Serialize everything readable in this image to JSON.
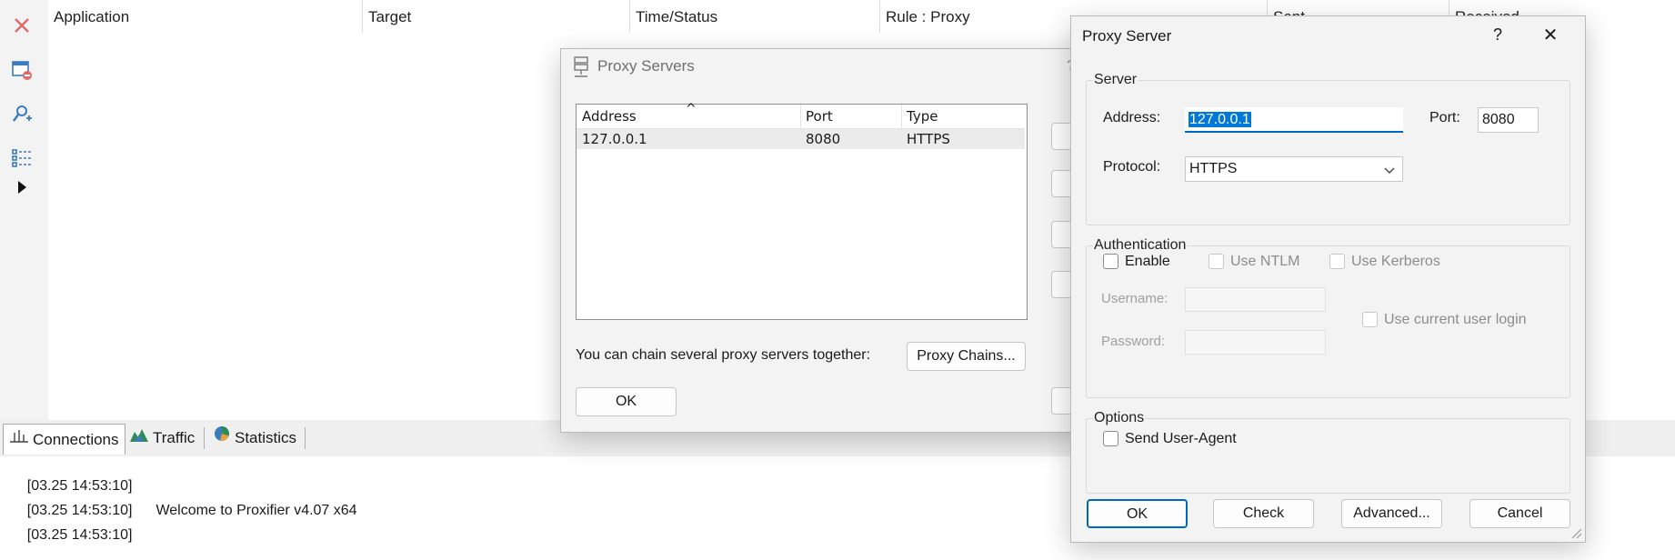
{
  "connections": {
    "columns": [
      "Application",
      "Target",
      "Time/Status",
      "Rule : Proxy",
      "Sent",
      "Received"
    ]
  },
  "toolbar": {
    "icons": [
      "close-x-icon",
      "window-remove-icon",
      "find-user-icon",
      "list-icon",
      "play-arrow-icon"
    ]
  },
  "tabs": [
    {
      "label": "Connections",
      "icon": "connections-icon"
    },
    {
      "label": "Traffic",
      "icon": "traffic-icon"
    },
    {
      "label": "Statistics",
      "icon": "statistics-icon"
    }
  ],
  "log": [
    {
      "time": "[03.25 14:53:10]",
      "message": ""
    },
    {
      "time": "[03.25 14:53:10]",
      "message": "Welcome to Proxifier v4.07 x64"
    },
    {
      "time": "[03.25 14:53:10]",
      "message": ""
    }
  ],
  "proxy_servers_dialog": {
    "title": "Proxy Servers",
    "columns": [
      "Address",
      "Port",
      "Type"
    ],
    "sort_indicator": "^",
    "rows": [
      {
        "address": "127.0.0.1",
        "port": "8080",
        "type": "HTTPS"
      }
    ],
    "chain_text": "You can chain several proxy servers together:",
    "proxy_chains_button": "Proxy Chains...",
    "ok_button": "OK",
    "title_help_partial": "?"
  },
  "proxy_server_dialog": {
    "title": "Proxy Server",
    "help": "?",
    "close": "✕",
    "server_group": "Server",
    "address_label": "Address:",
    "address_value": "127.0.0.1",
    "port_label": "Port:",
    "port_value": "8080",
    "protocol_label": "Protocol:",
    "protocol_value": "HTTPS",
    "auth_group": "Authentication",
    "enable_label": "Enable",
    "use_ntlm_label": "Use NTLM",
    "use_kerberos_label": "Use Kerberos",
    "username_label": "Username:",
    "password_label": "Password:",
    "use_current_login_label": "Use current user login",
    "options_group": "Options",
    "send_user_agent_label": "Send User-Agent",
    "ok_button": "OK",
    "check_button": "Check",
    "advanced_button": "Advanced...",
    "cancel_button": "Cancel"
  }
}
